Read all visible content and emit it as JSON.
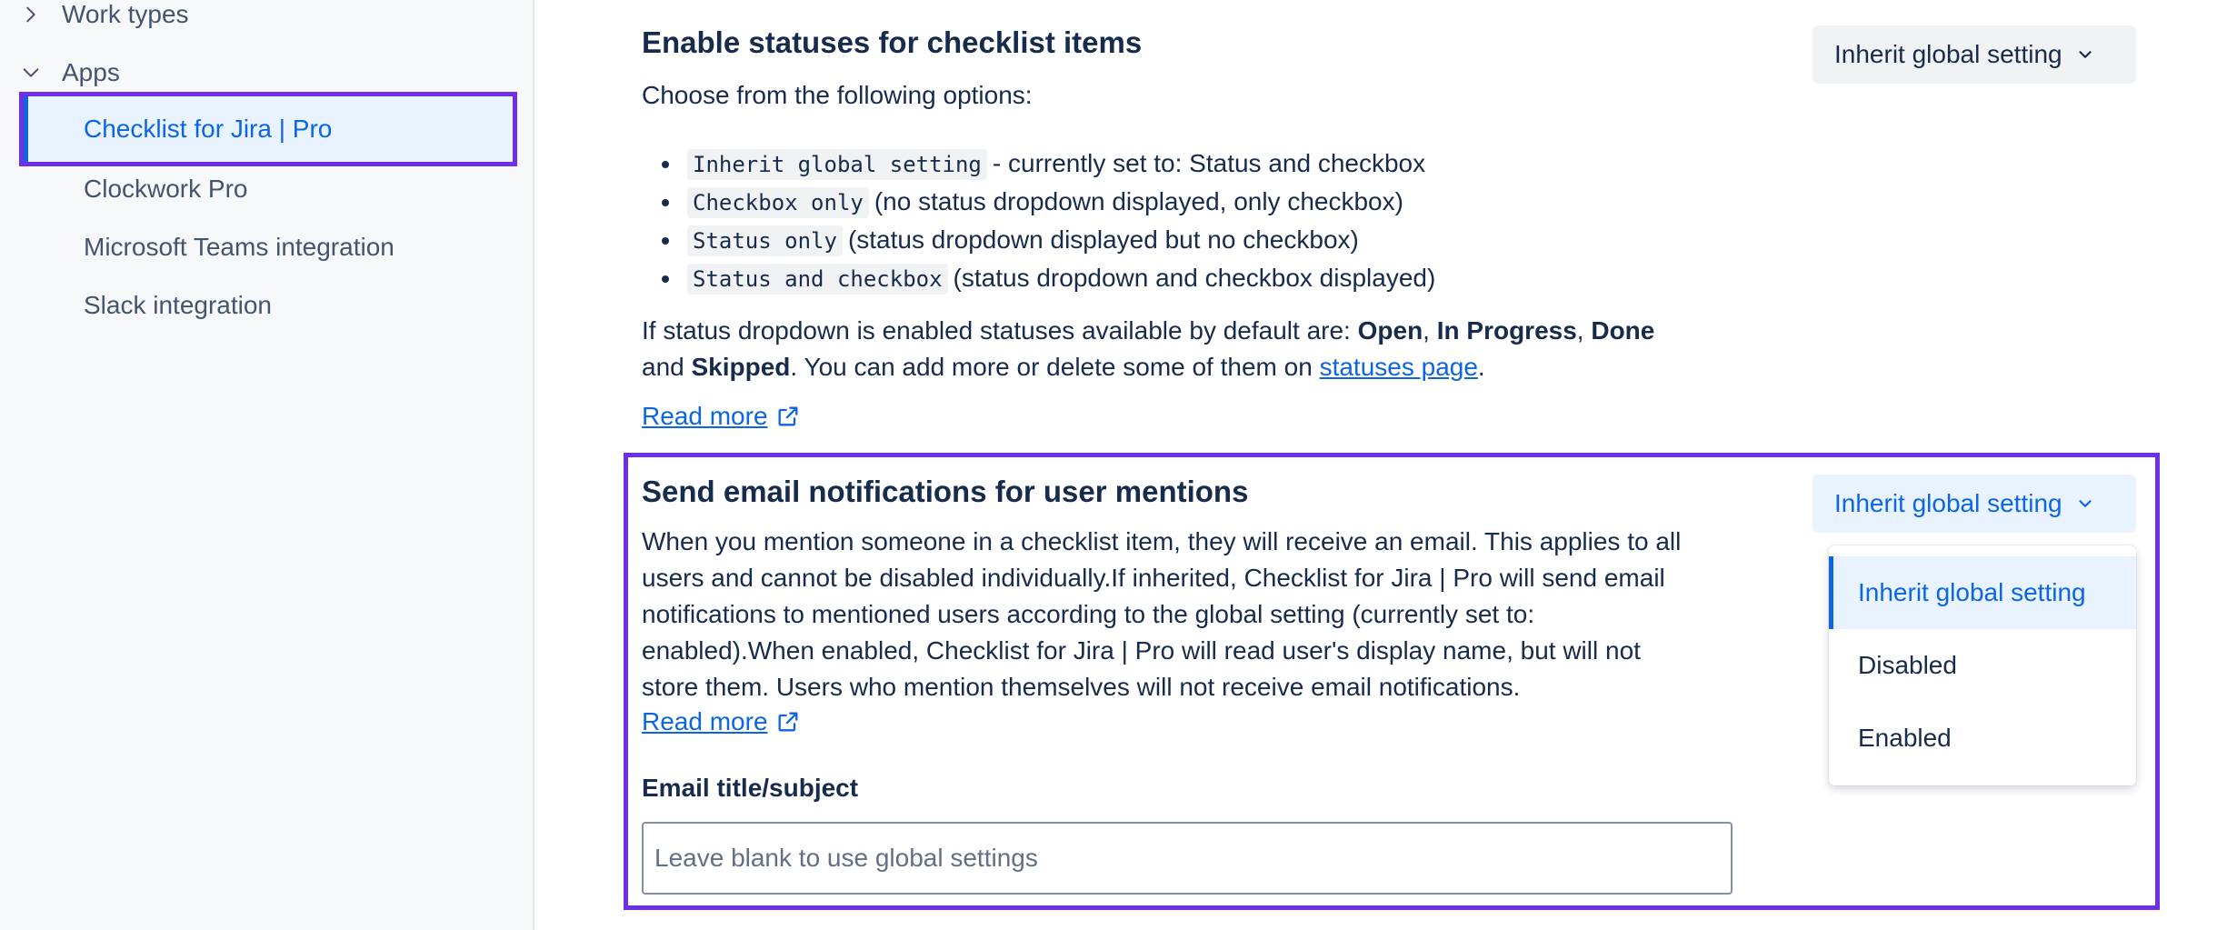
{
  "sidebar": {
    "work_types_label": "Work types",
    "apps_label": "Apps",
    "apps_items": [
      {
        "label": "Checklist for Jira | Pro",
        "selected": true
      },
      {
        "label": "Clockwork Pro"
      },
      {
        "label": "Microsoft Teams integration"
      },
      {
        "label": "Slack integration"
      }
    ]
  },
  "statuses_section": {
    "title": "Enable statuses for checklist items",
    "intro": "Choose from the following options:",
    "options": [
      {
        "code": "Inherit global setting",
        "text": "- currently set to: Status and checkbox"
      },
      {
        "code": "Checkbox only",
        "text": "(no status dropdown displayed, only checkbox)"
      },
      {
        "code": "Status only",
        "text": "(status dropdown displayed but no checkbox)"
      },
      {
        "code": "Status and checkbox",
        "text": "(status dropdown and checkbox displayed)"
      }
    ],
    "desc_line1_prefix": "If status dropdown is enabled statuses available by default are: ",
    "status_open": "Open",
    "status_in_progress": "In Progress",
    "status_done": "Done",
    "desc_line2_and": "and ",
    "status_skipped": "Skipped",
    "desc_line2_mid": ". You can add more or delete some of them on ",
    "statuses_link": "statuses page",
    "comma": ", ",
    "period": ".",
    "read_more": "Read more",
    "dropdown_value": "Inherit global setting"
  },
  "email_section": {
    "title": "Send email notifications for user mentions",
    "description_lines": [
      "When you mention someone in a checklist item, they will receive an email. This applies to all",
      "users and cannot be disabled individually.If inherited, Checklist for Jira | Pro will send email",
      "notifications to mentioned users according to the global setting (currently set to:",
      "enabled).When enabled, Checklist for Jira | Pro will read user's display name, but will not",
      "store them. Users who mention themselves will not receive email notifications."
    ],
    "read_more": "Read more",
    "dropdown_value": "Inherit global setting",
    "dropdown_options": [
      "Inherit global setting",
      "Disabled",
      "Enabled"
    ],
    "selected_option": "Inherit global setting",
    "email_title_label": "Email title/subject",
    "email_title_placeholder": "Leave blank to use global settings",
    "email_title_value": ""
  },
  "colors": {
    "accent": "#0c66e4",
    "highlight_outline": "#6e2fe8",
    "selected_bg": "#e9f2ff",
    "text": "#172b4d"
  },
  "icons": [
    "chevron-right-icon",
    "chevron-down-icon",
    "external-link-icon"
  ]
}
